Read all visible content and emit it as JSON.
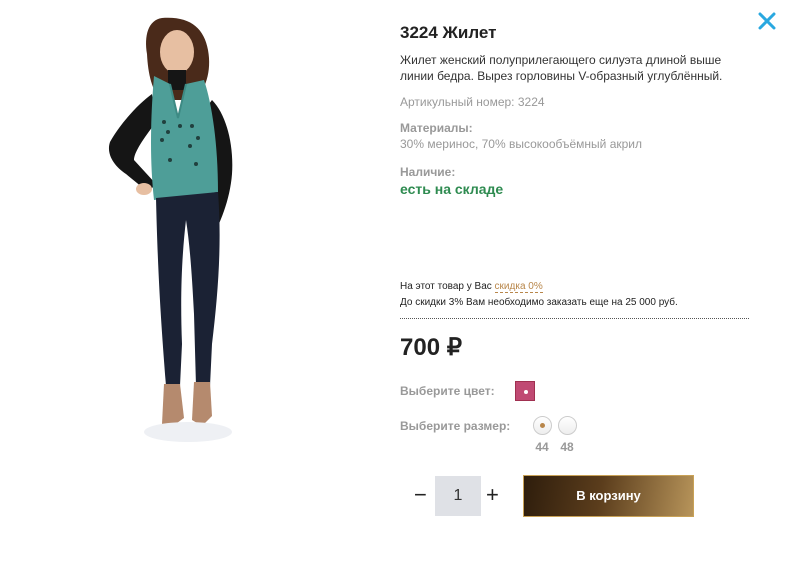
{
  "product": {
    "title": "3224 Жилет",
    "description": "Жилет женский полуприлегающего силуэта длиной выше линии бедра. Вырез горловины V-образный углублённый.",
    "article": "Артикульный номер: 3224",
    "materials_label": "Материалы:",
    "materials": "30% меринос, 70% высокообъёмный акрил",
    "availability_label": "Наличие:",
    "availability": "есть на складе"
  },
  "discount": {
    "line1_prefix": "На этот товар у Вас",
    "line1_link": "скидка 0%",
    "line2": "До скидки 3% Вам необходимо заказать еще на 25 000 руб."
  },
  "price": "700 ₽",
  "color": {
    "label": "Выберите цвет:",
    "selected": "#c04a73"
  },
  "size": {
    "label": "Выберите размер:",
    "options": [
      "44",
      "48"
    ],
    "selected": "44"
  },
  "quantity": {
    "minus": "−",
    "value": "1",
    "plus": "+"
  },
  "cart_button": "В корзину",
  "colors": {
    "availability": "#2e8b50",
    "accent": "#b8864a",
    "close": "#29a8e0"
  }
}
